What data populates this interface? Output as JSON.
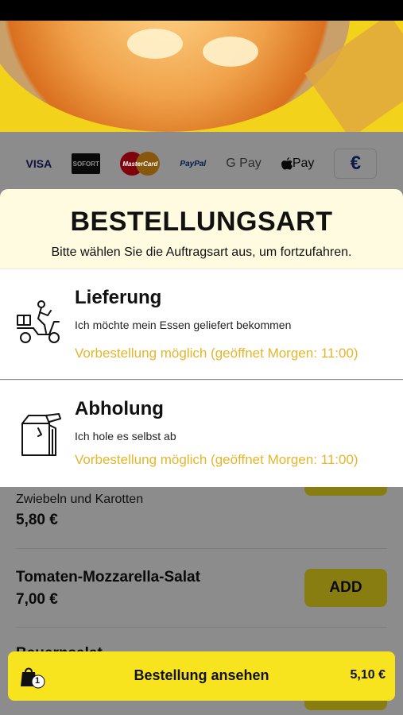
{
  "payments": {
    "visa": "VISA",
    "sofort": "SOFORT",
    "mastercard": "MasterCard",
    "paypal": "PayPal",
    "gpay": "G Pay",
    "applepay": "Pay",
    "euro": "€"
  },
  "menu": {
    "item1": {
      "desc": "Zwiebeln und Karotten",
      "price": "5,80 €"
    },
    "item2": {
      "name": "Tomaten-Mozzarella-Salat",
      "price": "7,00 €",
      "add_label": "ADD"
    },
    "item3": {
      "name": "Bauernsalat"
    }
  },
  "sheet": {
    "title": "BESTELLUNGSART",
    "subtitle": "Bitte wählen Sie die Auftragsart aus, um fortzufahren.",
    "options": [
      {
        "title": "Lieferung",
        "desc": "Ich möchte mein Essen geliefert bekommen",
        "note": "Vorbestellung möglich (geöffnet Morgen: 11:00)"
      },
      {
        "title": "Abholung",
        "desc": "Ich hole es selbst ab",
        "note": "Vorbestellung möglich (geöffnet Morgen: 11:00)"
      }
    ]
  },
  "cart": {
    "count": "1",
    "label": "Bestellung ansehen",
    "total": "5,10 €"
  },
  "colors": {
    "accent": "#f7e31e",
    "note": "#e5b52a",
    "sheet_header": "#fffbe0"
  },
  "icons": {
    "delivery": "scooter-icon",
    "pickup": "bag-icon",
    "cart": "shopping-bag-icon"
  }
}
